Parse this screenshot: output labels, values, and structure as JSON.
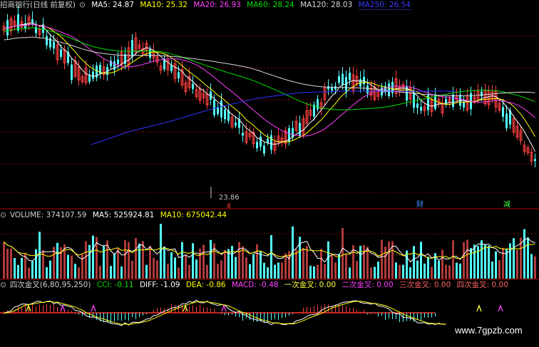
{
  "price_header": {
    "title": "招商银行(日线 前复权)",
    "ma5": "MA5: 24.87",
    "ma10": "MA10: 25.32",
    "ma20": "MA20: 26.93",
    "ma60": "MA60: 28.24",
    "ma120": "MA120: 28.03",
    "ma250": "MA250: 26.54"
  },
  "low_label": "23.86",
  "event_marks": {
    "a": "8",
    "b": "财",
    "c": "减"
  },
  "volume_header": {
    "title": "VOLUME: 374107.59",
    "ma5": "MA5: 525924.81",
    "ma10": "MA10: 675042.44"
  },
  "indicator_header": {
    "title": "四次金叉(6,80,95,250)",
    "cci": "CCI: -0.11",
    "diff": "DIFF: -1.09",
    "dea": "DEA: -0.86",
    "macd": "MACD: -0.48",
    "cross1": "一次金叉: 0.00",
    "cross2": "二次金叉: 0.00",
    "cross3": "三次金叉: 0.00",
    "cross4": "四次金叉: 0.00"
  },
  "watermark": "www.7gpzb.com",
  "colors": {
    "up": "#ff4040",
    "down": "#54ffff",
    "ma5": "#ffffff",
    "ma10": "#ffff00",
    "ma20": "#ff40ff",
    "ma60": "#00e000",
    "ma120": "#d8d8d8",
    "ma250": "#3030ff",
    "grid": "#8b0000",
    "vol_up": "#b03a3a"
  },
  "chart_data": [
    {
      "type": "candlestick",
      "title": "招商银行(日线 前复权)",
      "series": [
        {
          "name": "MA5",
          "last": 24.87
        },
        {
          "name": "MA10",
          "last": 25.32
        },
        {
          "name": "MA20",
          "last": 26.93
        },
        {
          "name": "MA60",
          "last": 28.24
        },
        {
          "name": "MA120",
          "last": 28.03
        },
        {
          "name": "MA250",
          "last": 26.54
        }
      ],
      "annotations": [
        "23.86"
      ]
    },
    {
      "type": "bar",
      "title": "VOLUME",
      "series": [
        {
          "name": "VOLUME",
          "last": 374107.59
        },
        {
          "name": "MA5",
          "last": 525924.81
        },
        {
          "name": "MA10",
          "last": 675042.44
        }
      ]
    },
    {
      "type": "line",
      "title": "四次金叉(6,80,95,250)",
      "series": [
        {
          "name": "CCI",
          "last": -0.11
        },
        {
          "name": "DIFF",
          "last": -1.09
        },
        {
          "name": "DEA",
          "last": -0.86
        },
        {
          "name": "MACD",
          "last": -0.48
        },
        {
          "name": "一次金叉",
          "last": 0.0
        },
        {
          "name": "二次金叉",
          "last": 0.0
        },
        {
          "name": "三次金叉",
          "last": 0.0
        },
        {
          "name": "四次金叉",
          "last": 0.0
        }
      ]
    }
  ]
}
